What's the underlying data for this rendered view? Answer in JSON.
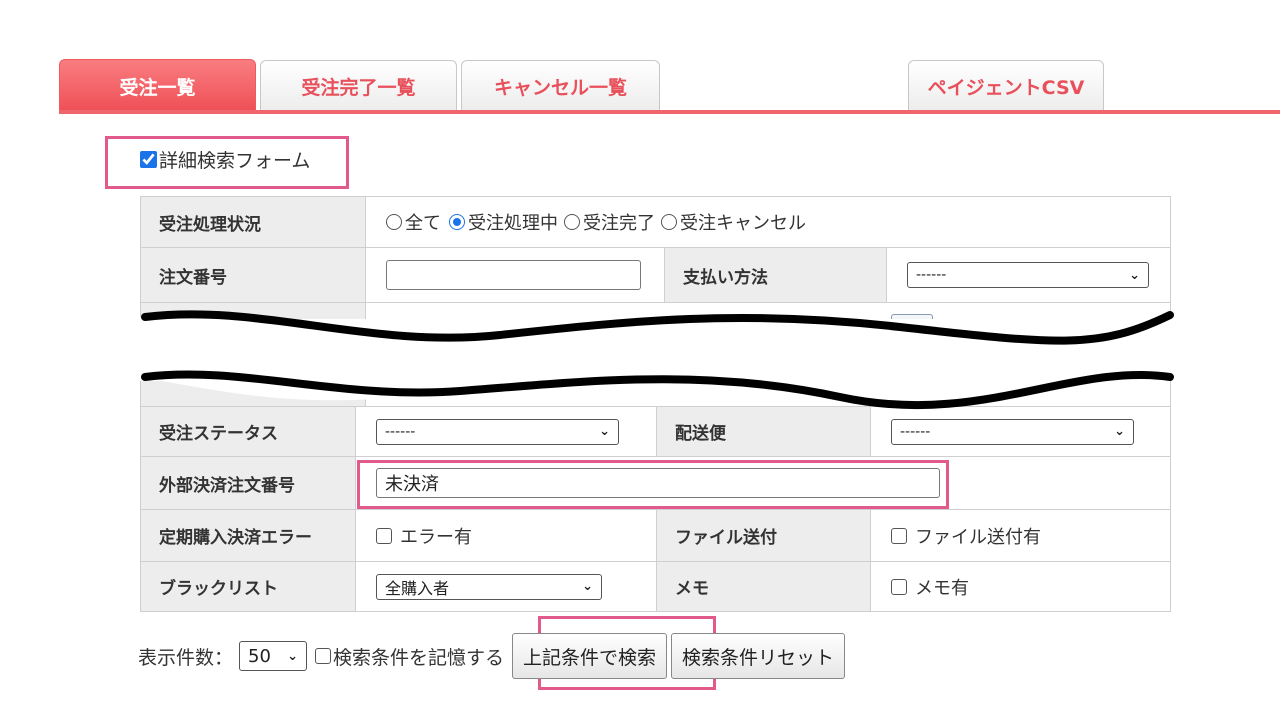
{
  "tabs": [
    {
      "label": "受注一覧",
      "active": true
    },
    {
      "label": "受注完了一覧",
      "active": false
    },
    {
      "label": "キャンセル一覧",
      "active": false
    },
    {
      "label": "ペイジェントCSV",
      "active": false
    }
  ],
  "detail_search": {
    "label": "詳細検索フォーム",
    "checked": true
  },
  "form": {
    "status": {
      "label": "受注処理状況",
      "options": [
        "全て",
        "受注処理中",
        "受注完了",
        "受注キャンセル"
      ],
      "selected": "受注処理中"
    },
    "order_number": {
      "label": "注文番号",
      "value": ""
    },
    "payment_method": {
      "label": "支払い方法",
      "value": "------"
    },
    "order_status": {
      "label": "受注ステータス",
      "value": "------"
    },
    "delivery": {
      "label": "配送便",
      "value": "------"
    },
    "external_payment": {
      "label": "外部決済注文番号",
      "value": "未決済"
    },
    "subscription_error": {
      "label": "定期購入決済エラー",
      "checkbox": "エラー有",
      "checked": false
    },
    "file_send": {
      "label": "ファイル送付",
      "checkbox": "ファイル送付有",
      "checked": false
    },
    "blacklist": {
      "label": "ブラックリスト",
      "value": "全購入者"
    },
    "memo": {
      "label": "メモ",
      "checkbox": "メモ有",
      "checked": false
    }
  },
  "bottom": {
    "per_page_label": "表示件数：",
    "per_page_value": "50",
    "remember_label": "検索条件を記憶する",
    "remember_checked": false,
    "search_button": "上記条件で検索",
    "reset_button": "検索条件リセット"
  },
  "colors": {
    "accent": "#ee4e55",
    "highlight": "#e25a8c",
    "checkbox": "#1a73e8"
  },
  "icons": {
    "calendar": "calendar-icon",
    "chevron": "chevron-down-icon"
  }
}
